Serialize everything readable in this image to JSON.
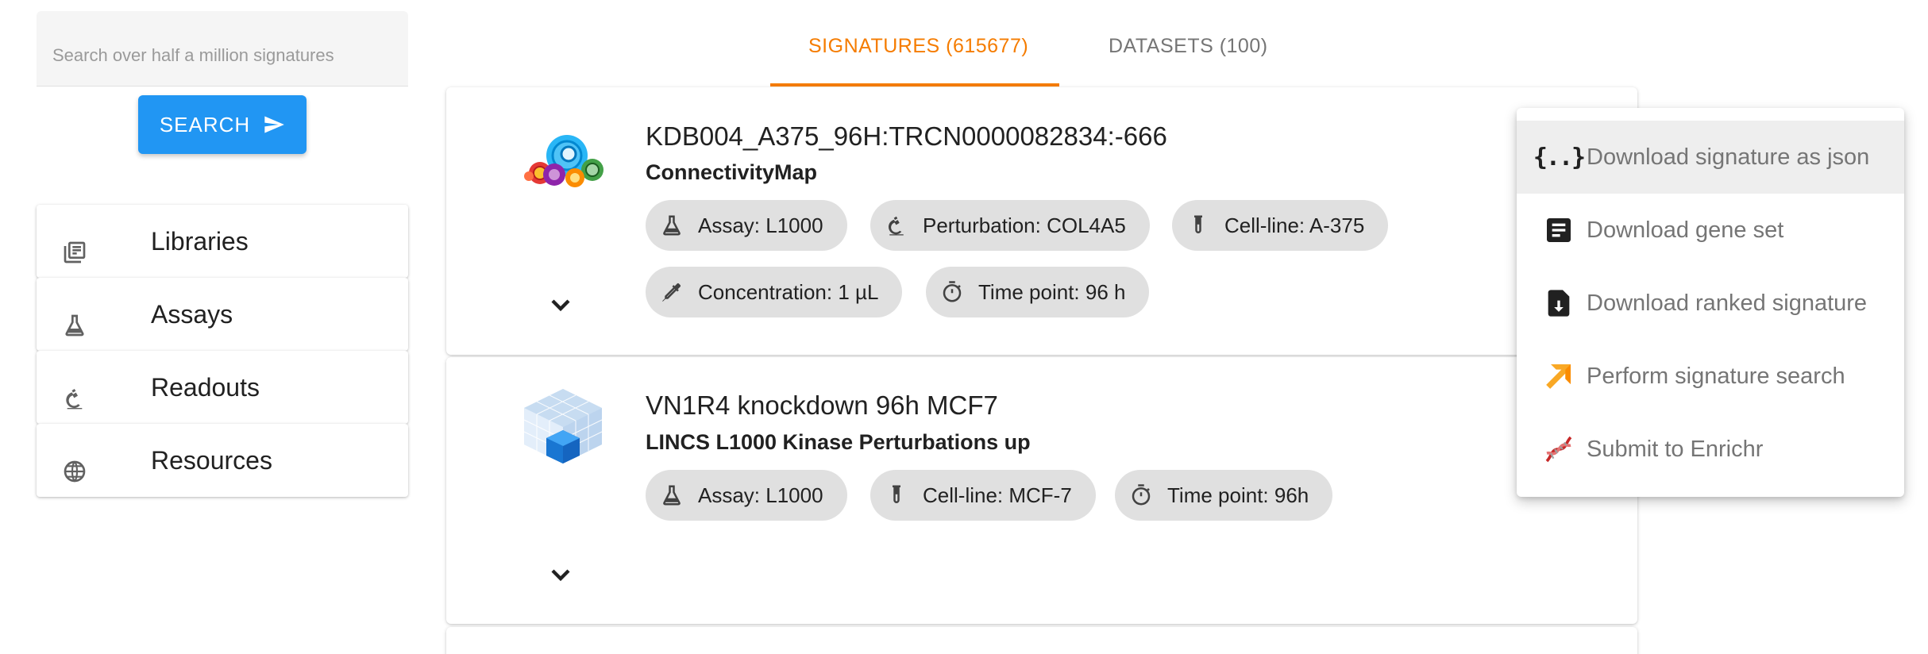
{
  "search": {
    "placeholder": "Search over half a million signatures",
    "button_label": "SEARCH"
  },
  "sidebar": {
    "items": [
      {
        "label": "Libraries",
        "icon": "library-books-icon"
      },
      {
        "label": "Assays",
        "icon": "flask-icon"
      },
      {
        "label": "Readouts",
        "icon": "microscope-icon"
      },
      {
        "label": "Resources",
        "icon": "globe-icon"
      }
    ]
  },
  "tabs": [
    {
      "label": "SIGNATURES (615677)",
      "active": true
    },
    {
      "label": "DATASETS (100)",
      "active": false
    }
  ],
  "results": [
    {
      "title": "KDB004_A375_96H:TRCN0000082834:-666",
      "library": "ConnectivityMap",
      "logo": "connectivity-map-logo",
      "chips": [
        {
          "label": "Assay: L1000",
          "icon": "flask-icon"
        },
        {
          "label": "Perturbation: COL4A5",
          "icon": "microscope-icon"
        },
        {
          "label": "Cell-line: A-375",
          "icon": "test-tube-icon"
        },
        {
          "label": "Concentration: 1 µL",
          "icon": "pipette-icon"
        },
        {
          "label": "Time point: 96 h",
          "icon": "timer-icon"
        }
      ]
    },
    {
      "title": "VN1R4 knockdown 96h MCF7",
      "library": "LINCS L1000 Kinase Perturbations up",
      "logo": "lincs-cube-logo",
      "chips": [
        {
          "label": "Assay: L1000",
          "icon": "flask-icon"
        },
        {
          "label": "Cell-line: MCF-7",
          "icon": "test-tube-icon"
        },
        {
          "label": "Time point: 96h",
          "icon": "timer-icon"
        }
      ]
    }
  ],
  "menu": {
    "items": [
      {
        "label": "Download signature as json",
        "icon": "json-icon",
        "glyph": "{..}",
        "active": true
      },
      {
        "label": "Download gene set",
        "icon": "document-icon",
        "active": false
      },
      {
        "label": "Download ranked signature",
        "icon": "file-download-icon",
        "active": false
      },
      {
        "label": "Perform signature search",
        "icon": "arrow-up-right-icon",
        "active": false
      },
      {
        "label": "Submit to Enrichr",
        "icon": "dna-icon",
        "active": false
      }
    ]
  },
  "colors": {
    "accent": "#f57c00",
    "primary": "#2196f3",
    "chip_bg": "#e0e0e0",
    "menu_active_bg": "#eeeeee",
    "enrichr_red": "#c62828",
    "search_arrow_orange": "#f9a825"
  }
}
